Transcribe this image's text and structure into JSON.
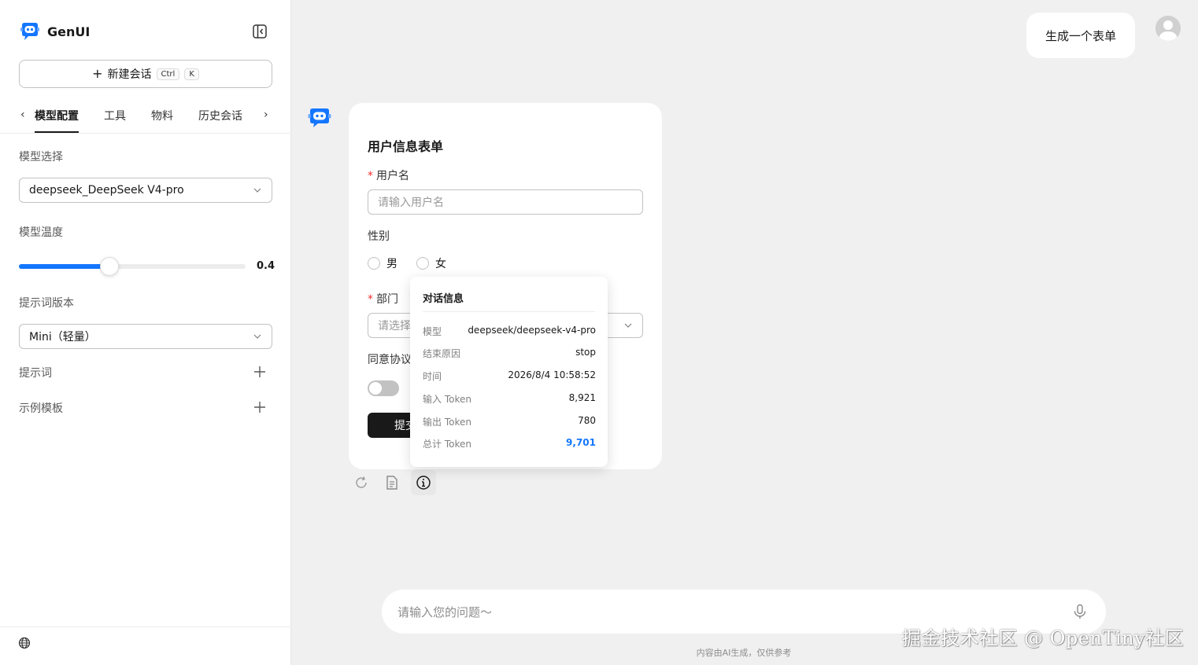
{
  "app": {
    "name": "GenUI"
  },
  "sidebar": {
    "new_chat": {
      "label": "新建会话",
      "shortcut_ctrl": "Ctrl",
      "shortcut_key": "K"
    },
    "tabs": [
      {
        "label": "模型配置",
        "active": true
      },
      {
        "label": "工具",
        "active": false
      },
      {
        "label": "物料",
        "active": false
      },
      {
        "label": "历史会话",
        "active": false
      }
    ],
    "model_select": {
      "label": "模型选择",
      "value": "deepseek_DeepSeek V4-pro"
    },
    "temperature": {
      "label": "模型温度",
      "value": "0.4",
      "fraction": 0.4
    },
    "prompt_version": {
      "label": "提示词版本",
      "value": "Mini（轻量）"
    },
    "prompt": {
      "label": "提示词"
    },
    "example_template": {
      "label": "示例模板"
    }
  },
  "chat": {
    "user_message": "生成一个表单",
    "form": {
      "title": "用户信息表单",
      "username": {
        "label": "用户名",
        "required": true,
        "placeholder": "请输入用户名"
      },
      "gender": {
        "label": "性别",
        "options": [
          "男",
          "女"
        ]
      },
      "department": {
        "label": "部门",
        "required": true,
        "placeholder": "请选择"
      },
      "agreement": {
        "label": "同意协议",
        "checked": false
      },
      "submit_label": "提交"
    },
    "info_popover": {
      "title": "对话信息",
      "rows": [
        {
          "key": "模型",
          "value": "deepseek/deepseek-v4-pro"
        },
        {
          "key": "结束原因",
          "value": "stop"
        },
        {
          "key": "时间",
          "value": "2026/8/4 10:58:52"
        },
        {
          "key": "输入 Token",
          "value": "8,921"
        },
        {
          "key": "输出 Token",
          "value": "780"
        },
        {
          "key": "总计 Token",
          "value": "9,701"
        }
      ]
    },
    "input_placeholder": "请输入您的问题～",
    "disclaimer": "内容由AI生成，仅供参考"
  },
  "watermark": "掘金技术社区 @ OpenTiny社区",
  "colors": {
    "accent": "#1476ff",
    "required": "#f23030",
    "submit_bg": "#191919"
  },
  "icons": [
    "brand-logo-icon",
    "sidebar-collapse-icon",
    "plus-icon",
    "chevron-left-icon",
    "chevron-right-icon",
    "chevron-down-icon",
    "globe-icon",
    "refresh-icon",
    "copy-icon",
    "info-icon",
    "mic-icon",
    "avatar"
  ]
}
